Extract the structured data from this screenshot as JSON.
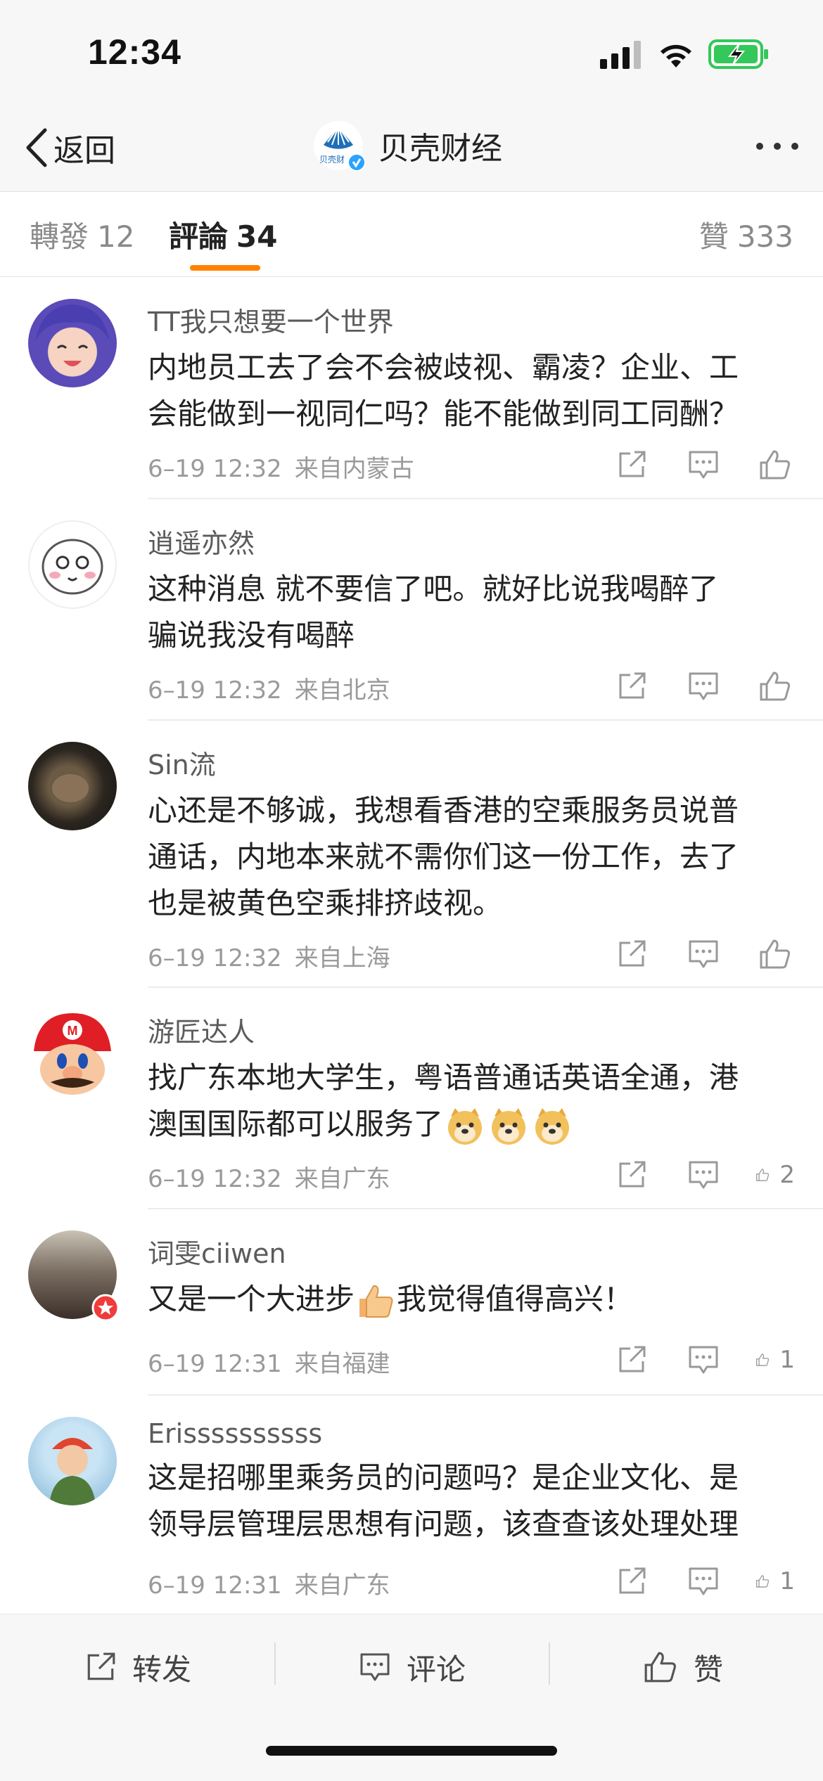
{
  "status": {
    "time": "12:34"
  },
  "nav": {
    "back_label": "返回",
    "brand_name": "贝壳财经",
    "brand_logo_text": "贝壳财"
  },
  "tabs": [
    {
      "label": "轉發",
      "count": "12"
    },
    {
      "label": "評論",
      "count": "34"
    },
    {
      "label": "贊",
      "count": "333"
    }
  ],
  "comments": [
    {
      "username": "TT我只想要一个世界",
      "lines": [
        "内地员工去了会不会被歧视、霸凌？企业、工",
        "会能做到一视同仁吗？能不能做到同工同酬？"
      ],
      "date": "6–19 12:32",
      "source": "来自内蒙古",
      "likes": ""
    },
    {
      "username": "逍遥亦然",
      "lines": [
        "这种消息 就不要信了吧。就好比说我喝醉了",
        "骗说我没有喝醉"
      ],
      "date": "6–19 12:32",
      "source": "来自北京",
      "likes": ""
    },
    {
      "username": "Sin流",
      "lines": [
        "心还是不够诚，我想看香港的空乘服务员说普",
        "通话，内地本来就不需你们这一份工作，去了",
        "也是被黄色空乘排挤歧视。"
      ],
      "date": "6–19 12:32",
      "source": "来自上海",
      "likes": ""
    },
    {
      "username": "游匠达人",
      "lines": [
        "找广东本地大学生，粤语普通话英语全通，港",
        "澳国国际都可以服务了"
      ],
      "date": "6–19 12:32",
      "source": "来自广东",
      "likes": "2"
    },
    {
      "username": "词雯ciiwen",
      "lines": [
        "又是一个大进步",
        "我觉得值得高兴！"
      ],
      "date": "6–19 12:31",
      "source": "来自福建",
      "likes": "1"
    },
    {
      "username": "Erissssssssss",
      "lines": [
        "这是招哪里乘务员的问题吗？是企业文化、是",
        "领导层管理层思想有问题，该查查该处理处理"
      ],
      "date": "6–19 12:31",
      "source": "来自广东",
      "likes": "1"
    }
  ],
  "bottom_bar": {
    "repost": "转发",
    "comment": "评论",
    "like": "赞"
  },
  "colors": {
    "accent": "#ff8200",
    "verified": "#2aa3ff",
    "battery": "#34c759"
  }
}
